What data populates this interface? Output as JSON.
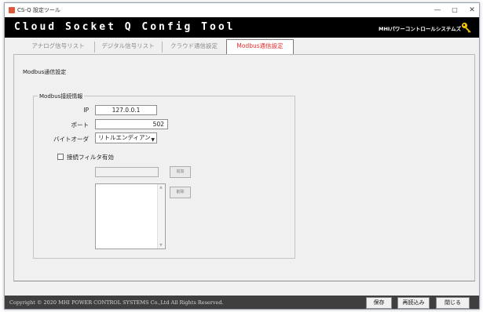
{
  "window": {
    "title": "CS-Q 設定ツール",
    "controls": {
      "minimize": "—",
      "maximize": "□",
      "close": "✕"
    }
  },
  "banner": {
    "title": "Cloud Socket Q Config Tool",
    "company": "MHIパワーコントロールシステムズ",
    "icon": "key-icon"
  },
  "tabs": [
    {
      "label": "アナログ信号リスト",
      "active": false
    },
    {
      "label": "デジタル信号リスト",
      "active": false
    },
    {
      "label": "クラウド通信設定",
      "active": false
    },
    {
      "label": "Modbus通信設定",
      "active": true
    }
  ],
  "section_title": "Modbus通信設定",
  "group": {
    "legend": "Modbus接続情報",
    "ip_label": "IP",
    "ip_value": "127.0.0.1",
    "port_label": "ポート",
    "port_value": "502",
    "byte_order_label": "バイトオーダ",
    "byte_order_value": "リトルエンディアン",
    "filter_label": "接続フィルタ有効",
    "filter_checked": false,
    "filter_input_value": "",
    "add_button": "追加",
    "delete_button": "削除"
  },
  "footer": {
    "copyright": "Copyright © 2020  MHI POWER CONTROL SYSTEMS Co.,Ltd All Rights Reserved.",
    "save": "保存",
    "reload": "再読込み",
    "close": "閉じる"
  },
  "colors": {
    "banner_bg": "#000000",
    "active_tab_text": "#e52a2a",
    "footer_bg": "#3f3f3f",
    "key_icon": "#f2c200"
  }
}
